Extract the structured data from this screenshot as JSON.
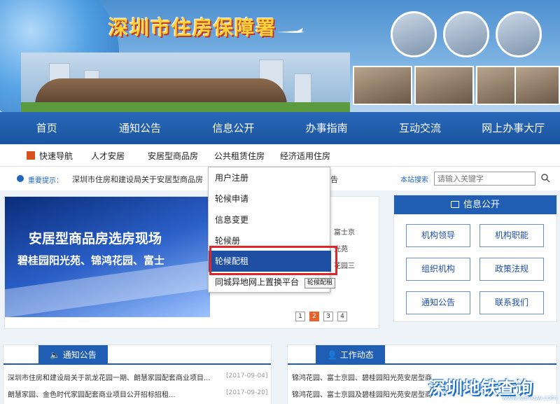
{
  "header": {
    "site_title": "深圳市住房保障署"
  },
  "main_nav": [
    "首页",
    "通知公告",
    "信息公开",
    "办事指南",
    "互动交流",
    "网上办事大厅"
  ],
  "sub_nav": {
    "quick_nav": "快速导航",
    "items": [
      "人才安居",
      "安居型商品房",
      "公共租赁住房",
      "经济适用住房"
    ]
  },
  "notice": {
    "label": "重要提示：",
    "text": "深圳市住房和建设局关于安居型商品房",
    "tail": "告",
    "search_label": "本站搜索",
    "search_placeholder": "请输入关键字"
  },
  "dropdown": {
    "items": [
      "用户注册",
      "轮候申请",
      "信息变更",
      "轮候册",
      "轮候配租",
      "同城异地网上置换平台"
    ],
    "selected_index": 4,
    "tooltip": "轮候配租"
  },
  "carousel": {
    "line1": "安居型商品房选房现场",
    "line2": "碧桂园阳光苑、锦鸿花园、富士",
    "side": [
      "富士京",
      "光苑",
      "花园三"
    ],
    "pages": [
      "1",
      "2",
      "3",
      "4"
    ],
    "current_page": 2
  },
  "info_panel": {
    "title": "信息公开",
    "buttons": [
      "机构领导",
      "机构职能",
      "组织机构",
      "政策法规",
      "通知公告",
      "联系我们"
    ]
  },
  "notice_box": {
    "title": "通知公告",
    "rows": [
      {
        "text": "深圳市住房和建设局关于凯龙花园一期、朗慧家园配套商业项目...",
        "date": "[2017-09-04]"
      },
      {
        "text": "朗慧家园、金色时代家园配套商业项目公开招标招租...",
        "date": "[2017-09-20]"
      }
    ]
  },
  "work_box": {
    "title": "工作动态",
    "rows": [
      {
        "text": "锦鸿花园、富士京园、碧桂园阳光苑安居型商品房..."
      },
      {
        "text": "锦鸿花园、富士京园及碧桂园阳光苑安居型商品房..."
      }
    ]
  },
  "watermark": {
    "main": "深圳地铁查询",
    "url": "www.kanxsw.com"
  },
  "colors": {
    "nav_blue": "#1f5eb3",
    "highlight_red": "#e0262b",
    "accent_orange": "#e8632b"
  }
}
